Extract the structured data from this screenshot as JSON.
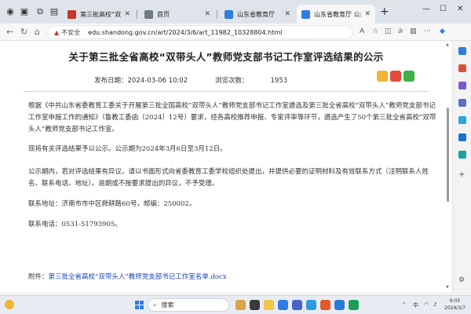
{
  "tabs": [
    {
      "label": "第三批高校“双带头人”",
      "active": false
    },
    {
      "label": "首页",
      "active": false
    },
    {
      "label": "山东省教育厅",
      "active": false
    },
    {
      "label": "山东省教育厅 公示(",
      "active": true
    }
  ],
  "new_tab": "+",
  "address": {
    "security_text": "不安全",
    "url": "edu.shandong.gov.cn/art/2024/3/6/art_11982_10328804.html"
  },
  "article": {
    "title": "关于第三批全省高校“双带头人”教师党支部书记工作室评选结果的公示",
    "publish_label": "发布日期：",
    "publish_date": "2024-03-06 10:02",
    "views_label": "浏览次数：",
    "views": "1953",
    "paragraphs": [
      "根据《中共山东省委教育工委关于开展第三批全国高校“双带头人”教师党支部书记工作室遴选及第三批全省高校“双带头人”教师党支部书记工作室申报工作的通知》（鲁教工委函〔2024〕12号）要求，经各高校推荐申报、专家评审等环节，遴选产生了50个第三批全省高校“双带头人”教师党支部书记工作室。",
      "现将有关评选结果予以公示。公示期为2024年3月6日至3月12日。",
      "公示期内，若对评选结果有异议，请以书面形式向省委教育工委学校组织处提出，并提供必要的证明材料及有效联系方式（注明联系人姓名、联系电话、地址）。逾期或不按要求提出的异议，不予受理。",
      "联系地址：济南市市中区舜耕路60号，邮编：250002。",
      "联系电话：0531-51793905。"
    ],
    "attachment_label": "附件：",
    "attachment_link": "第三批全省高校“双带头人”教师党支部书记工作室名单.docx"
  },
  "taskbar": {
    "search_label": "搜索",
    "tray_lang": "中",
    "time": "9:05",
    "date": "2024/3/7"
  },
  "colors": {
    "link": "#1a3fb6",
    "accent": "#2f7de1"
  }
}
